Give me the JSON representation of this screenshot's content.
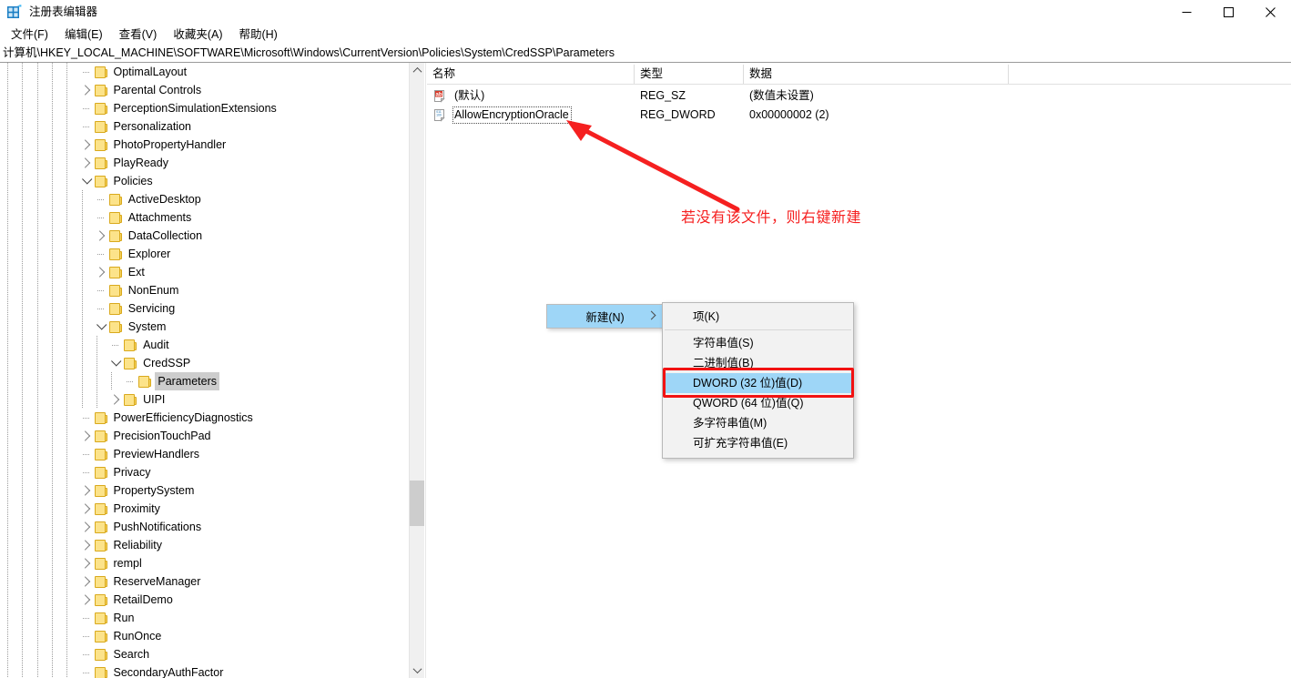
{
  "window": {
    "title": "注册表编辑器",
    "app_icon": "registry-grid-icon",
    "controls": {
      "minimize": "—",
      "maximize": "□",
      "close": "✕"
    }
  },
  "menubar": {
    "items": [
      {
        "label": "文件(F)",
        "name": "menu-file"
      },
      {
        "label": "编辑(E)",
        "name": "menu-edit"
      },
      {
        "label": "查看(V)",
        "name": "menu-view"
      },
      {
        "label": "收藏夹(A)",
        "name": "menu-favorites"
      },
      {
        "label": "帮助(H)",
        "name": "menu-help"
      }
    ]
  },
  "address": {
    "path": "计算机\\HKEY_LOCAL_MACHINE\\SOFTWARE\\Microsoft\\Windows\\CurrentVersion\\Policies\\System\\CredSSP\\Parameters"
  },
  "tree": {
    "nodes": [
      {
        "label": "OptimalLayout",
        "depth": 5,
        "expander": "none",
        "selected": false
      },
      {
        "label": "Parental Controls",
        "depth": 5,
        "expander": "closed",
        "selected": false
      },
      {
        "label": "PerceptionSimulationExtensions",
        "depth": 5,
        "expander": "none",
        "selected": false
      },
      {
        "label": "Personalization",
        "depth": 5,
        "expander": "none",
        "selected": false
      },
      {
        "label": "PhotoPropertyHandler",
        "depth": 5,
        "expander": "closed",
        "selected": false
      },
      {
        "label": "PlayReady",
        "depth": 5,
        "expander": "closed",
        "selected": false
      },
      {
        "label": "Policies",
        "depth": 5,
        "expander": "open",
        "selected": false
      },
      {
        "label": "ActiveDesktop",
        "depth": 6,
        "expander": "none",
        "selected": false
      },
      {
        "label": "Attachments",
        "depth": 6,
        "expander": "none",
        "selected": false
      },
      {
        "label": "DataCollection",
        "depth": 6,
        "expander": "closed",
        "selected": false
      },
      {
        "label": "Explorer",
        "depth": 6,
        "expander": "none",
        "selected": false
      },
      {
        "label": "Ext",
        "depth": 6,
        "expander": "closed",
        "selected": false
      },
      {
        "label": "NonEnum",
        "depth": 6,
        "expander": "none",
        "selected": false
      },
      {
        "label": "Servicing",
        "depth": 6,
        "expander": "none",
        "selected": false
      },
      {
        "label": "System",
        "depth": 6,
        "expander": "open",
        "selected": false
      },
      {
        "label": "Audit",
        "depth": 7,
        "expander": "none",
        "selected": false
      },
      {
        "label": "CredSSP",
        "depth": 7,
        "expander": "open",
        "selected": false
      },
      {
        "label": "Parameters",
        "depth": 8,
        "expander": "none",
        "selected": true
      },
      {
        "label": "UIPI",
        "depth": 7,
        "expander": "closed",
        "selected": false
      },
      {
        "label": "PowerEfficiencyDiagnostics",
        "depth": 5,
        "expander": "none",
        "selected": false
      },
      {
        "label": "PrecisionTouchPad",
        "depth": 5,
        "expander": "closed",
        "selected": false
      },
      {
        "label": "PreviewHandlers",
        "depth": 5,
        "expander": "none",
        "selected": false
      },
      {
        "label": "Privacy",
        "depth": 5,
        "expander": "none",
        "selected": false
      },
      {
        "label": "PropertySystem",
        "depth": 5,
        "expander": "closed",
        "selected": false
      },
      {
        "label": "Proximity",
        "depth": 5,
        "expander": "closed",
        "selected": false
      },
      {
        "label": "PushNotifications",
        "depth": 5,
        "expander": "closed",
        "selected": false
      },
      {
        "label": "Reliability",
        "depth": 5,
        "expander": "closed",
        "selected": false
      },
      {
        "label": "rempl",
        "depth": 5,
        "expander": "closed",
        "selected": false
      },
      {
        "label": "ReserveManager",
        "depth": 5,
        "expander": "closed",
        "selected": false
      },
      {
        "label": "RetailDemo",
        "depth": 5,
        "expander": "closed",
        "selected": false
      },
      {
        "label": "Run",
        "depth": 5,
        "expander": "none",
        "selected": false
      },
      {
        "label": "RunOnce",
        "depth": 5,
        "expander": "none",
        "selected": false
      },
      {
        "label": "Search",
        "depth": 5,
        "expander": "none",
        "selected": false
      },
      {
        "label": "SecondaryAuthFactor",
        "depth": 5,
        "expander": "none",
        "selected": false
      }
    ]
  },
  "values": {
    "columns": [
      "名称",
      "类型",
      "数据"
    ],
    "rows": [
      {
        "icon": "string-value-icon",
        "name": "(默认)",
        "type": "REG_SZ",
        "data": "(数值未设置)",
        "focused": false
      },
      {
        "icon": "dword-value-icon",
        "name": "AllowEncryptionOracle",
        "type": "REG_DWORD",
        "data": "0x00000002 (2)",
        "focused": true
      }
    ]
  },
  "context_menu": {
    "parent_label": "新建(N)",
    "parent_arrow_icon": "chevron-right-icon",
    "items": [
      {
        "label": "项(K)",
        "highlight": false,
        "separator_after": true
      },
      {
        "label": "字符串值(S)",
        "highlight": false,
        "separator_after": false
      },
      {
        "label": "二进制值(B)",
        "highlight": false,
        "separator_after": false
      },
      {
        "label": "DWORD (32 位)值(D)",
        "highlight": true,
        "separator_after": false
      },
      {
        "label": "QWORD (64 位)值(Q)",
        "highlight": false,
        "separator_after": false
      },
      {
        "label": "多字符串值(M)",
        "highlight": false,
        "separator_after": false
      },
      {
        "label": "可扩充字符串值(E)",
        "highlight": false,
        "separator_after": false
      }
    ]
  },
  "annotations": {
    "note_text": "若没有该文件，则右键新建",
    "note_color": "#f52020",
    "highlight_color": "#f21212",
    "arrow_color": "#f52020"
  }
}
